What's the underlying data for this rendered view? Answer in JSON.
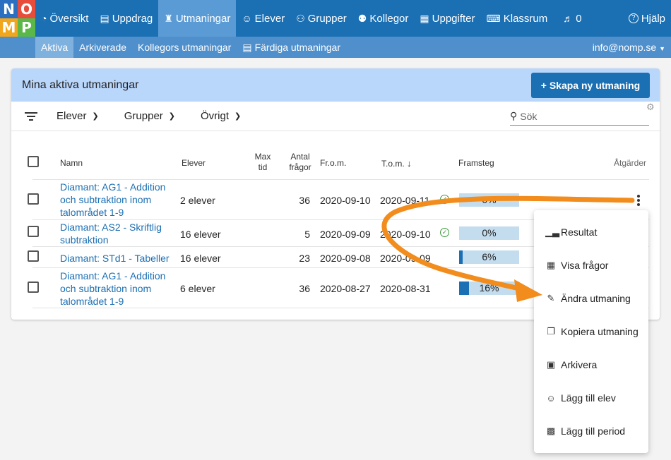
{
  "logo": {
    "letters": [
      "N",
      "O",
      "M",
      "P"
    ]
  },
  "nav": {
    "items": [
      {
        "label": "Översikt",
        "icon": "dashboard-icon",
        "glyph": "◔"
      },
      {
        "label": "Uppdrag",
        "icon": "book-icon",
        "glyph": "▤"
      },
      {
        "label": "Utmaningar",
        "icon": "trophy-icon",
        "glyph": "♜"
      },
      {
        "label": "Elever",
        "icon": "user-icon",
        "glyph": "☺"
      },
      {
        "label": "Grupper",
        "icon": "users-icon",
        "glyph": "⚇"
      },
      {
        "label": "Kollegor",
        "icon": "colleagues-icon",
        "glyph": "⚉"
      },
      {
        "label": "Uppgifter",
        "icon": "grid-icon",
        "glyph": "▦"
      },
      {
        "label": "Klassrum",
        "icon": "classroom-icon",
        "glyph": "⌨"
      },
      {
        "label": "0",
        "icon": "bell-icon",
        "glyph": "🔔"
      }
    ],
    "help": {
      "label": "Hjälp",
      "glyph": "?"
    }
  },
  "subnav": {
    "items": [
      "Aktiva",
      "Arkiverade",
      "Kollegors utmaningar",
      "Färdiga utmaningar"
    ],
    "user": "info@nomp.se"
  },
  "card": {
    "title": "Mina aktiva utmaningar",
    "new_button": "+ Skapa ny utmaning",
    "filters": [
      "Elever",
      "Grupper",
      "Övrigt"
    ],
    "search_placeholder": "Sök"
  },
  "table": {
    "headers": {
      "name": "Namn",
      "students": "Elever",
      "max_time": "Max tid",
      "questions": "Antal frågor",
      "from": "Fr.o.m.",
      "to": "T.o.m.",
      "progress": "Framsteg",
      "actions": "Åtgärder"
    },
    "rows": [
      {
        "name": "Diamant: AG1 - Addition och subtraktion inom talområdet 1-9",
        "students": "2 elever",
        "questions": "36",
        "from": "2020-09-10",
        "to": "2020-09-11",
        "progress": 0,
        "progress_label": "0%",
        "done": true
      },
      {
        "name": "Diamant: AS2 - Skriftlig subtraktion",
        "students": "16 elever",
        "questions": "5",
        "from": "2020-09-09",
        "to": "2020-09-10",
        "progress": 0,
        "progress_label": "0%",
        "done": true
      },
      {
        "name": "Diamant: STd1 - Tabeller",
        "students": "16 elever",
        "questions": "23",
        "from": "2020-09-08",
        "to": "2020-09-09",
        "progress": 6,
        "progress_label": "6%",
        "done": false
      },
      {
        "name": "Diamant: AG1 - Addition och subtraktion inom talområdet 1-9",
        "students": "6 elever",
        "questions": "36",
        "from": "2020-08-27",
        "to": "2020-08-31",
        "progress": 16,
        "progress_label": "16%",
        "done": false
      }
    ]
  },
  "menu": {
    "items": [
      {
        "label": "Resultat",
        "icon": "chart-icon",
        "glyph": "⊥"
      },
      {
        "label": "Visa frågor",
        "icon": "table-icon",
        "glyph": "▦"
      },
      {
        "label": "Ändra utmaning",
        "icon": "edit-icon",
        "glyph": "✎"
      },
      {
        "label": "Kopiera utmaning",
        "icon": "copy-icon",
        "glyph": "❐"
      },
      {
        "label": "Arkivera",
        "icon": "archive-icon",
        "glyph": "▭"
      },
      {
        "label": "Lägg till elev",
        "icon": "add-user-icon",
        "glyph": "☺"
      },
      {
        "label": "Lägg till period",
        "icon": "calendar-add-icon",
        "glyph": "▣"
      }
    ]
  },
  "colors": {
    "primary": "#1b6fb3",
    "arrow": "#f28c1c",
    "check": "#3a9a3a"
  }
}
